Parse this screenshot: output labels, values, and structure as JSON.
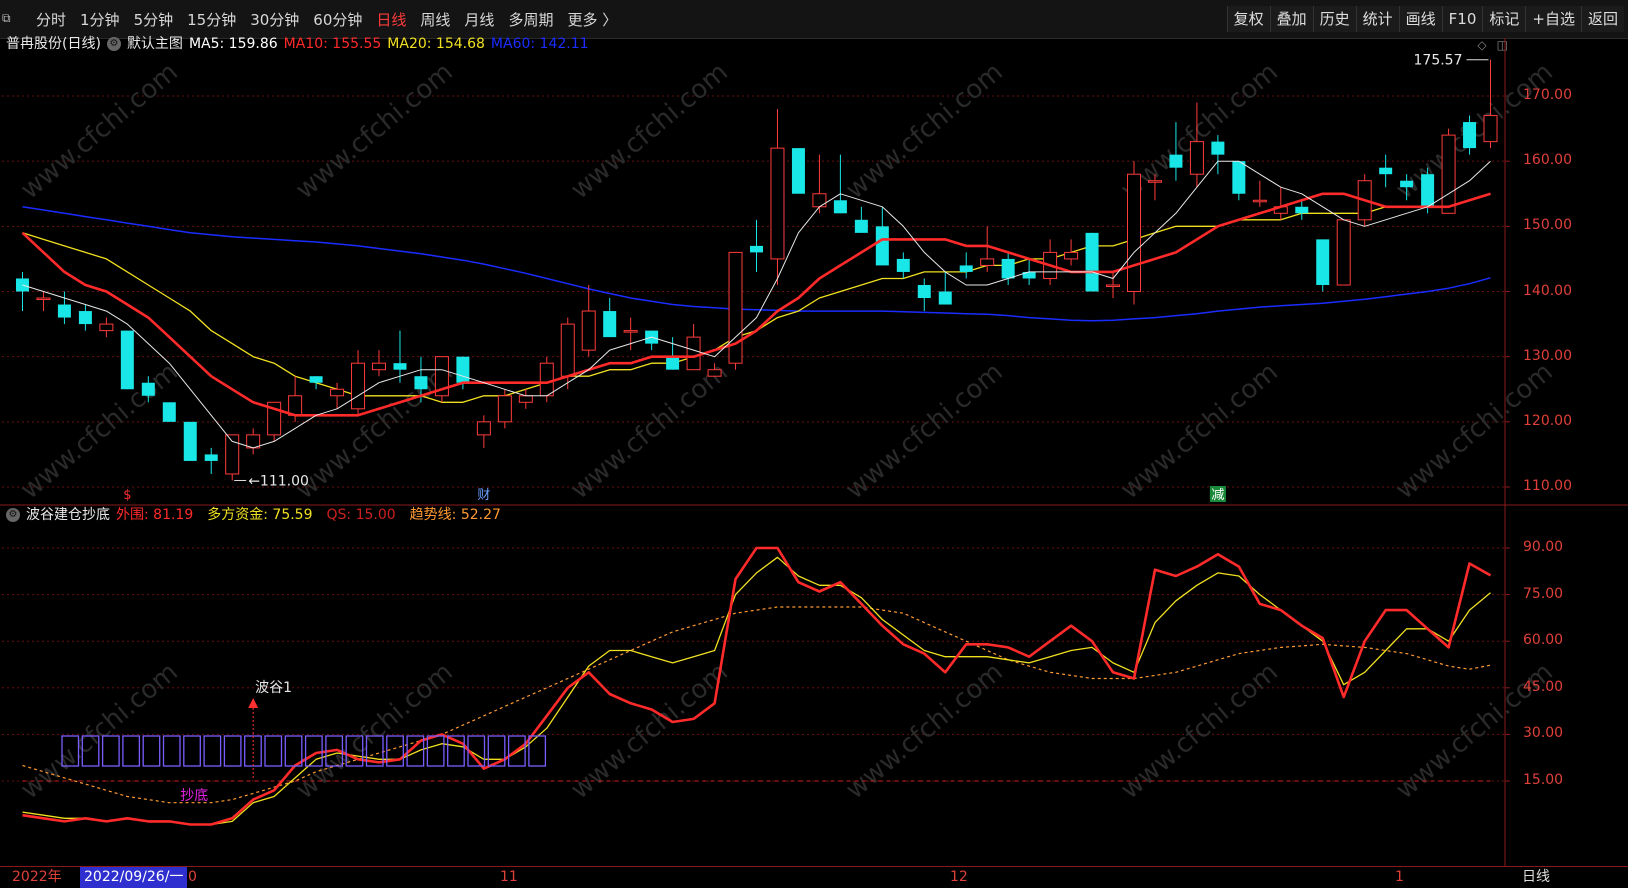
{
  "toolbar": {
    "window_icon": "window-restore-icon",
    "period_tabs": [
      "分时",
      "1分钟",
      "5分钟",
      "15分钟",
      "30分钟",
      "60分钟",
      "日线",
      "周线",
      "月线",
      "多周期",
      "更多 〉"
    ],
    "active_tab": "日线",
    "right_tools": [
      "复权",
      "叠加",
      "历史",
      "统计",
      "画线",
      "F10",
      "标记",
      "+自选",
      "返回"
    ]
  },
  "main_chart": {
    "stock_name": "普冉股份(日线)",
    "template": "默认主图",
    "ma": [
      {
        "label": "MA5: 159.86",
        "color": "#ffffff"
      },
      {
        "label": "MA10: 155.55",
        "color": "#ff2a2a"
      },
      {
        "label": "MA20: 154.68",
        "color": "#f0e020"
      },
      {
        "label": "MA60: 142.11",
        "color": "#1a2cff"
      }
    ],
    "y_ticks": [
      "170.00",
      "160.00",
      "150.00",
      "140.00",
      "130.00",
      "120.00",
      "110.00"
    ],
    "high_label": "175.57",
    "low_label": "111.00",
    "markers": [
      {
        "text": "$",
        "color": "#ff3030"
      },
      {
        "text": "财",
        "color": "#6aa0ff"
      },
      {
        "text": "减",
        "color": "#ffffff"
      }
    ]
  },
  "sub_chart": {
    "name": "波谷建仓抄底",
    "values": [
      {
        "label": "外围: 81.19",
        "color": "#ff2a2a"
      },
      {
        "label": "多方资金: 75.59",
        "color": "#f0e020"
      },
      {
        "label": "QS: 15.00",
        "color": "#cc2020"
      },
      {
        "label": "趋势线: 52.27",
        "color": "#ff9a30"
      }
    ],
    "y_ticks": [
      "90.00",
      "75.00",
      "60.00",
      "45.00",
      "30.00",
      "15.00"
    ],
    "annotation_trough": "波谷1",
    "annotation_bottom": "抄底"
  },
  "x_axis": {
    "year_label": "2022年",
    "cursor_date": "2022/09/26/一",
    "month_labels": [
      "0",
      "11",
      "12",
      "1"
    ],
    "period": "日线"
  },
  "chart_data": {
    "type": "candlestick",
    "title": "普冉股份(日线)",
    "ylim": [
      108,
      178
    ],
    "candles": [
      {
        "o": 142,
        "h": 143,
        "l": 137,
        "c": 140
      },
      {
        "o": 139,
        "h": 140,
        "l": 137,
        "c": 139
      },
      {
        "o": 138,
        "h": 140,
        "l": 135,
        "c": 136
      },
      {
        "o": 137,
        "h": 138,
        "l": 134,
        "c": 135
      },
      {
        "o": 134,
        "h": 136,
        "l": 133,
        "c": 135
      },
      {
        "o": 134,
        "h": 134,
        "l": 125,
        "c": 125
      },
      {
        "o": 126,
        "h": 127,
        "l": 123,
        "c": 124
      },
      {
        "o": 123,
        "h": 123,
        "l": 120,
        "c": 120
      },
      {
        "o": 120,
        "h": 120,
        "l": 114,
        "c": 114
      },
      {
        "o": 115,
        "h": 116,
        "l": 112,
        "c": 114
      },
      {
        "o": 112,
        "h": 118,
        "l": 111,
        "c": 118
      },
      {
        "o": 116,
        "h": 119,
        "l": 115,
        "c": 118
      },
      {
        "o": 118,
        "h": 123,
        "l": 117,
        "c": 123
      },
      {
        "o": 121,
        "h": 127,
        "l": 120,
        "c": 124
      },
      {
        "o": 127,
        "h": 127,
        "l": 125,
        "c": 126
      },
      {
        "o": 124,
        "h": 126,
        "l": 122,
        "c": 125
      },
      {
        "o": 122,
        "h": 131,
        "l": 121,
        "c": 129
      },
      {
        "o": 128,
        "h": 131,
        "l": 127,
        "c": 129
      },
      {
        "o": 129,
        "h": 134,
        "l": 126,
        "c": 128
      },
      {
        "o": 127,
        "h": 130,
        "l": 123,
        "c": 125
      },
      {
        "o": 124,
        "h": 130,
        "l": 123,
        "c": 130
      },
      {
        "o": 130,
        "h": 130,
        "l": 125,
        "c": 126
      },
      {
        "o": 118,
        "h": 121,
        "l": 116,
        "c": 120
      },
      {
        "o": 120,
        "h": 125,
        "l": 119,
        "c": 124
      },
      {
        "o": 123,
        "h": 125,
        "l": 122,
        "c": 124
      },
      {
        "o": 124,
        "h": 130,
        "l": 123,
        "c": 129
      },
      {
        "o": 127,
        "h": 136,
        "l": 125,
        "c": 135
      },
      {
        "o": 131,
        "h": 141,
        "l": 130,
        "c": 137
      },
      {
        "o": 137,
        "h": 139,
        "l": 133,
        "c": 133
      },
      {
        "o": 134,
        "h": 136,
        "l": 131,
        "c": 134
      },
      {
        "o": 134,
        "h": 134,
        "l": 131,
        "c": 132
      },
      {
        "o": 130,
        "h": 133,
        "l": 128,
        "c": 128
      },
      {
        "o": 128,
        "h": 135,
        "l": 128,
        "c": 133
      },
      {
        "o": 127,
        "h": 129,
        "l": 127,
        "c": 128
      },
      {
        "o": 129,
        "h": 146,
        "l": 128,
        "c": 146
      },
      {
        "o": 147,
        "h": 151,
        "l": 143,
        "c": 146
      },
      {
        "o": 145,
        "h": 168,
        "l": 141,
        "c": 162
      },
      {
        "o": 162,
        "h": 162,
        "l": 156,
        "c": 155
      },
      {
        "o": 153,
        "h": 161,
        "l": 152,
        "c": 155
      },
      {
        "o": 154,
        "h": 161,
        "l": 152,
        "c": 152
      },
      {
        "o": 151,
        "h": 153,
        "l": 149,
        "c": 149
      },
      {
        "o": 150,
        "h": 153,
        "l": 144,
        "c": 144
      },
      {
        "o": 145,
        "h": 146,
        "l": 142,
        "c": 143
      },
      {
        "o": 141,
        "h": 142,
        "l": 137,
        "c": 139
      },
      {
        "o": 140,
        "h": 143,
        "l": 138,
        "c": 138
      },
      {
        "o": 144,
        "h": 146,
        "l": 142,
        "c": 143
      },
      {
        "o": 144,
        "h": 150,
        "l": 143,
        "c": 145
      },
      {
        "o": 145,
        "h": 146,
        "l": 141,
        "c": 142
      },
      {
        "o": 143,
        "h": 145,
        "l": 141,
        "c": 142
      },
      {
        "o": 142,
        "h": 148,
        "l": 141,
        "c": 146
      },
      {
        "o": 145,
        "h": 148,
        "l": 144,
        "c": 146
      },
      {
        "o": 149,
        "h": 149,
        "l": 140,
        "c": 140
      },
      {
        "o": 141,
        "h": 143,
        "l": 139,
        "c": 141
      },
      {
        "o": 140,
        "h": 160,
        "l": 138,
        "c": 158
      },
      {
        "o": 157,
        "h": 158,
        "l": 154,
        "c": 157
      },
      {
        "o": 161,
        "h": 166,
        "l": 157,
        "c": 159
      },
      {
        "o": 158,
        "h": 169,
        "l": 156,
        "c": 163
      },
      {
        "o": 163,
        "h": 164,
        "l": 158,
        "c": 161
      },
      {
        "o": 160,
        "h": 160,
        "l": 154,
        "c": 155
      },
      {
        "o": 154,
        "h": 157,
        "l": 153,
        "c": 154
      },
      {
        "o": 152,
        "h": 156,
        "l": 151,
        "c": 153
      },
      {
        "o": 153,
        "h": 154,
        "l": 151,
        "c": 152
      },
      {
        "o": 148,
        "h": 148,
        "l": 140,
        "c": 141
      },
      {
        "o": 141,
        "h": 150,
        "l": 141,
        "c": 151
      },
      {
        "o": 151,
        "h": 158,
        "l": 150,
        "c": 157
      },
      {
        "o": 159,
        "h": 161,
        "l": 156,
        "c": 158
      },
      {
        "o": 157,
        "h": 158,
        "l": 154,
        "c": 156
      },
      {
        "o": 158,
        "h": 159,
        "l": 152,
        "c": 153
      },
      {
        "o": 152,
        "h": 165,
        "l": 152,
        "c": 164
      },
      {
        "o": 166,
        "h": 167,
        "l": 161,
        "c": 162
      },
      {
        "o": 163,
        "h": 175.57,
        "l": 162,
        "c": 167
      }
    ],
    "ma5": [
      141,
      140,
      139,
      138,
      137,
      135,
      132,
      129,
      125,
      121,
      117,
      116,
      117,
      119,
      121,
      122,
      124,
      126,
      127,
      128,
      128,
      127,
      126,
      125,
      124,
      124,
      126,
      128,
      131,
      132,
      133,
      132,
      131,
      130,
      133,
      136,
      142,
      149,
      153,
      155,
      154,
      153,
      150,
      146,
      143,
      141,
      141,
      142,
      143,
      143,
      143,
      143,
      142,
      146,
      149,
      152,
      156,
      160,
      160,
      158,
      156,
      155,
      153,
      151,
      150,
      151,
      152,
      153,
      155,
      157,
      160
    ],
    "ma10": [
      149,
      146,
      143,
      141,
      140,
      138,
      136,
      133,
      130,
      127,
      125,
      123,
      122,
      121,
      121,
      121,
      121,
      122,
      123,
      124,
      125,
      126,
      126,
      126,
      126,
      126,
      127,
      128,
      129,
      129,
      130,
      130,
      130,
      131,
      132,
      134,
      137,
      139,
      142,
      144,
      146,
      148,
      148,
      148,
      148,
      147,
      147,
      146,
      145,
      144,
      143,
      143,
      143,
      144,
      145,
      146,
      148,
      150,
      151,
      152,
      153,
      154,
      155,
      155,
      154,
      153,
      153,
      153,
      153,
      154,
      155
    ],
    "ma20": [
      149,
      148,
      147,
      146,
      145,
      143,
      141,
      139,
      137,
      134,
      132,
      130,
      129,
      127,
      126,
      125,
      124,
      124,
      124,
      124,
      123,
      123,
      124,
      124,
      125,
      126,
      127,
      127,
      128,
      128,
      129,
      129,
      130,
      131,
      133,
      134,
      136,
      137,
      139,
      140,
      141,
      142,
      142,
      143,
      143,
      143,
      144,
      144,
      145,
      145,
      146,
      147,
      147,
      148,
      149,
      150,
      150,
      150,
      151,
      151,
      151,
      152,
      152,
      152,
      152,
      153,
      153,
      153,
      153,
      154,
      155
    ],
    "ma60": [
      153,
      152.5,
      152,
      151.5,
      151,
      150.5,
      150,
      149.5,
      149,
      148.7,
      148.4,
      148.2,
      148,
      147.8,
      147.6,
      147.3,
      147,
      146.6,
      146.2,
      145.8,
      145.3,
      144.8,
      144.2,
      143.5,
      142.8,
      142,
      141.2,
      140.4,
      139.7,
      139,
      138.5,
      138,
      137.7,
      137.5,
      137.3,
      137.2,
      137.1,
      137,
      137,
      137,
      137,
      137,
      136.9,
      136.8,
      136.7,
      136.6,
      136.5,
      136.3,
      136,
      135.8,
      135.6,
      135.5,
      135.6,
      135.8,
      136,
      136.3,
      136.6,
      137,
      137.3,
      137.6,
      137.8,
      138,
      138.2,
      138.5,
      138.8,
      139.2,
      139.6,
      140,
      140.5,
      141.2,
      142.1
    ],
    "sub_ylim": [
      0,
      100
    ],
    "sub_series": [
      {
        "name": "外围",
        "color": "#ff2a2a",
        "values": [
          4,
          3,
          2,
          3,
          2,
          3,
          2,
          2,
          1,
          1,
          3,
          9,
          12,
          20,
          24,
          25,
          22,
          21,
          22,
          28,
          30,
          27,
          19,
          22,
          27,
          36,
          45,
          50,
          43,
          40,
          38,
          34,
          35,
          40,
          80,
          90,
          90,
          79,
          76,
          79,
          72,
          65,
          59,
          56,
          50,
          59,
          59,
          58,
          55,
          60,
          65,
          60,
          50,
          48,
          83,
          81,
          84,
          88,
          84,
          72,
          70,
          65,
          61,
          42,
          60,
          70,
          70,
          64,
          58,
          85,
          81.19
        ]
      },
      {
        "name": "多方资金",
        "color": "#f0e020",
        "values": [
          5,
          4,
          3,
          3,
          2,
          3,
          2,
          2,
          1,
          1,
          2,
          8,
          10,
          16,
          22,
          24,
          23,
          22,
          22,
          25,
          27,
          26,
          22,
          22,
          26,
          32,
          42,
          52,
          57,
          57,
          55,
          53,
          55,
          57,
          75,
          82,
          87,
          81,
          78,
          78,
          74,
          67,
          62,
          57,
          55,
          55,
          55,
          54,
          53,
          55,
          57,
          58,
          53,
          50,
          66,
          73,
          78,
          82,
          81,
          75,
          70,
          65,
          60,
          46,
          50,
          57,
          64,
          64,
          60,
          70,
          75.59
        ]
      },
      {
        "name": "QS",
        "color": "#cc2020",
        "values": [
          15,
          15,
          15,
          15,
          15,
          15,
          15,
          15,
          15,
          15,
          15,
          15,
          15,
          15,
          15,
          15,
          15,
          15,
          15,
          15,
          15,
          15,
          15,
          15,
          15,
          15,
          15,
          15,
          15,
          15,
          15,
          15,
          15,
          15,
          15,
          15,
          15,
          15,
          15,
          15,
          15,
          15,
          15,
          15,
          15,
          15,
          15,
          15,
          15,
          15,
          15,
          15,
          15,
          15,
          15,
          15,
          15,
          15,
          15,
          15,
          15,
          15,
          15,
          15,
          15,
          15,
          15,
          15,
          15,
          15,
          15
        ]
      },
      {
        "name": "趋势线",
        "color": "#ff9a30",
        "values": [
          20,
          18,
          16,
          14,
          12,
          10,
          9,
          8,
          8,
          8,
          9,
          11,
          13,
          15,
          18,
          20,
          22,
          24,
          26,
          28,
          30,
          33,
          36,
          39,
          42,
          45,
          48,
          51,
          54,
          57,
          60,
          63,
          65,
          67,
          69,
          70,
          71,
          71,
          71,
          71,
          71,
          70,
          69,
          66,
          63,
          60,
          57,
          54,
          52,
          50,
          49,
          48,
          48,
          48,
          49,
          50,
          52,
          54,
          56,
          57,
          58,
          58.5,
          59,
          58.5,
          58,
          57,
          56,
          54,
          52,
          51,
          52.27
        ]
      }
    ],
    "box_count": 24
  }
}
